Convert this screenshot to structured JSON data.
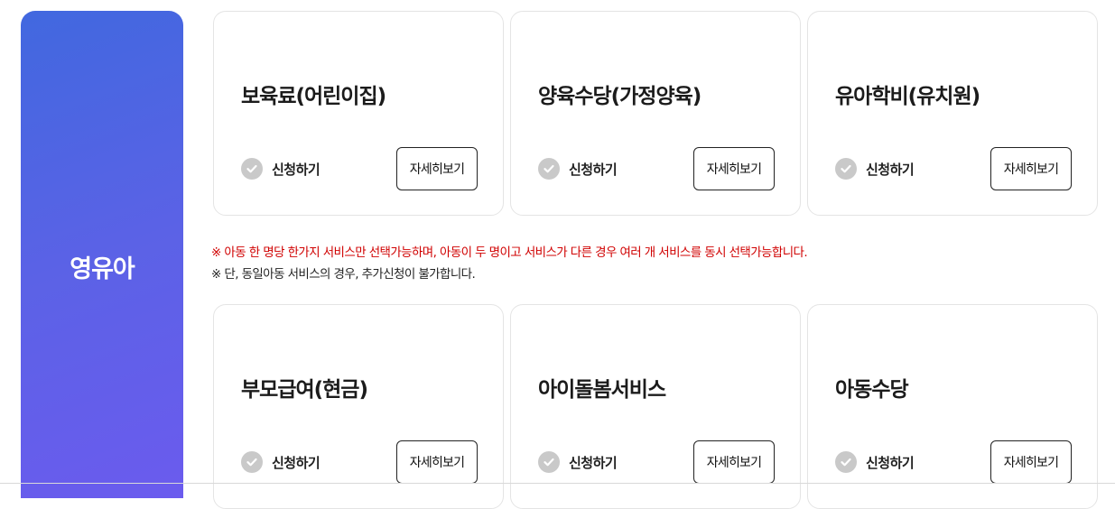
{
  "category": {
    "title": "영유아"
  },
  "cards": [
    {
      "title": "보육료(어린이집)",
      "apply_label": "신청하기",
      "detail_label": "자세히보기"
    },
    {
      "title": "양육수당(가정양육)",
      "apply_label": "신청하기",
      "detail_label": "자세히보기"
    },
    {
      "title": "유아학비(유치원)",
      "apply_label": "신청하기",
      "detail_label": "자세히보기"
    },
    {
      "title": "부모급여(현금)",
      "apply_label": "신청하기",
      "detail_label": "자세히보기"
    },
    {
      "title": "아이돌봄서비스",
      "apply_label": "신청하기",
      "detail_label": "자세히보기"
    },
    {
      "title": "아동수당",
      "apply_label": "신청하기",
      "detail_label": "자세히보기"
    }
  ],
  "notices": {
    "red": "※ 아동 한 명당 한가지 서비스만 선택가능하며, 아동이 두 명이고 서비스가 다른 경우 여러 개 서비스를 동시 선택가능합니다.",
    "dark": "※ 단, 동일아동 서비스의 경우, 추가신청이 불가합니다."
  },
  "colors": {
    "sidebar_gradient_start": "#4168df",
    "sidebar_gradient_end": "#6b5bee",
    "notice_red": "#d00000",
    "check_icon_gray": "#c9c9c9"
  },
  "icons": {
    "apply_icon": "check-circle-icon"
  }
}
